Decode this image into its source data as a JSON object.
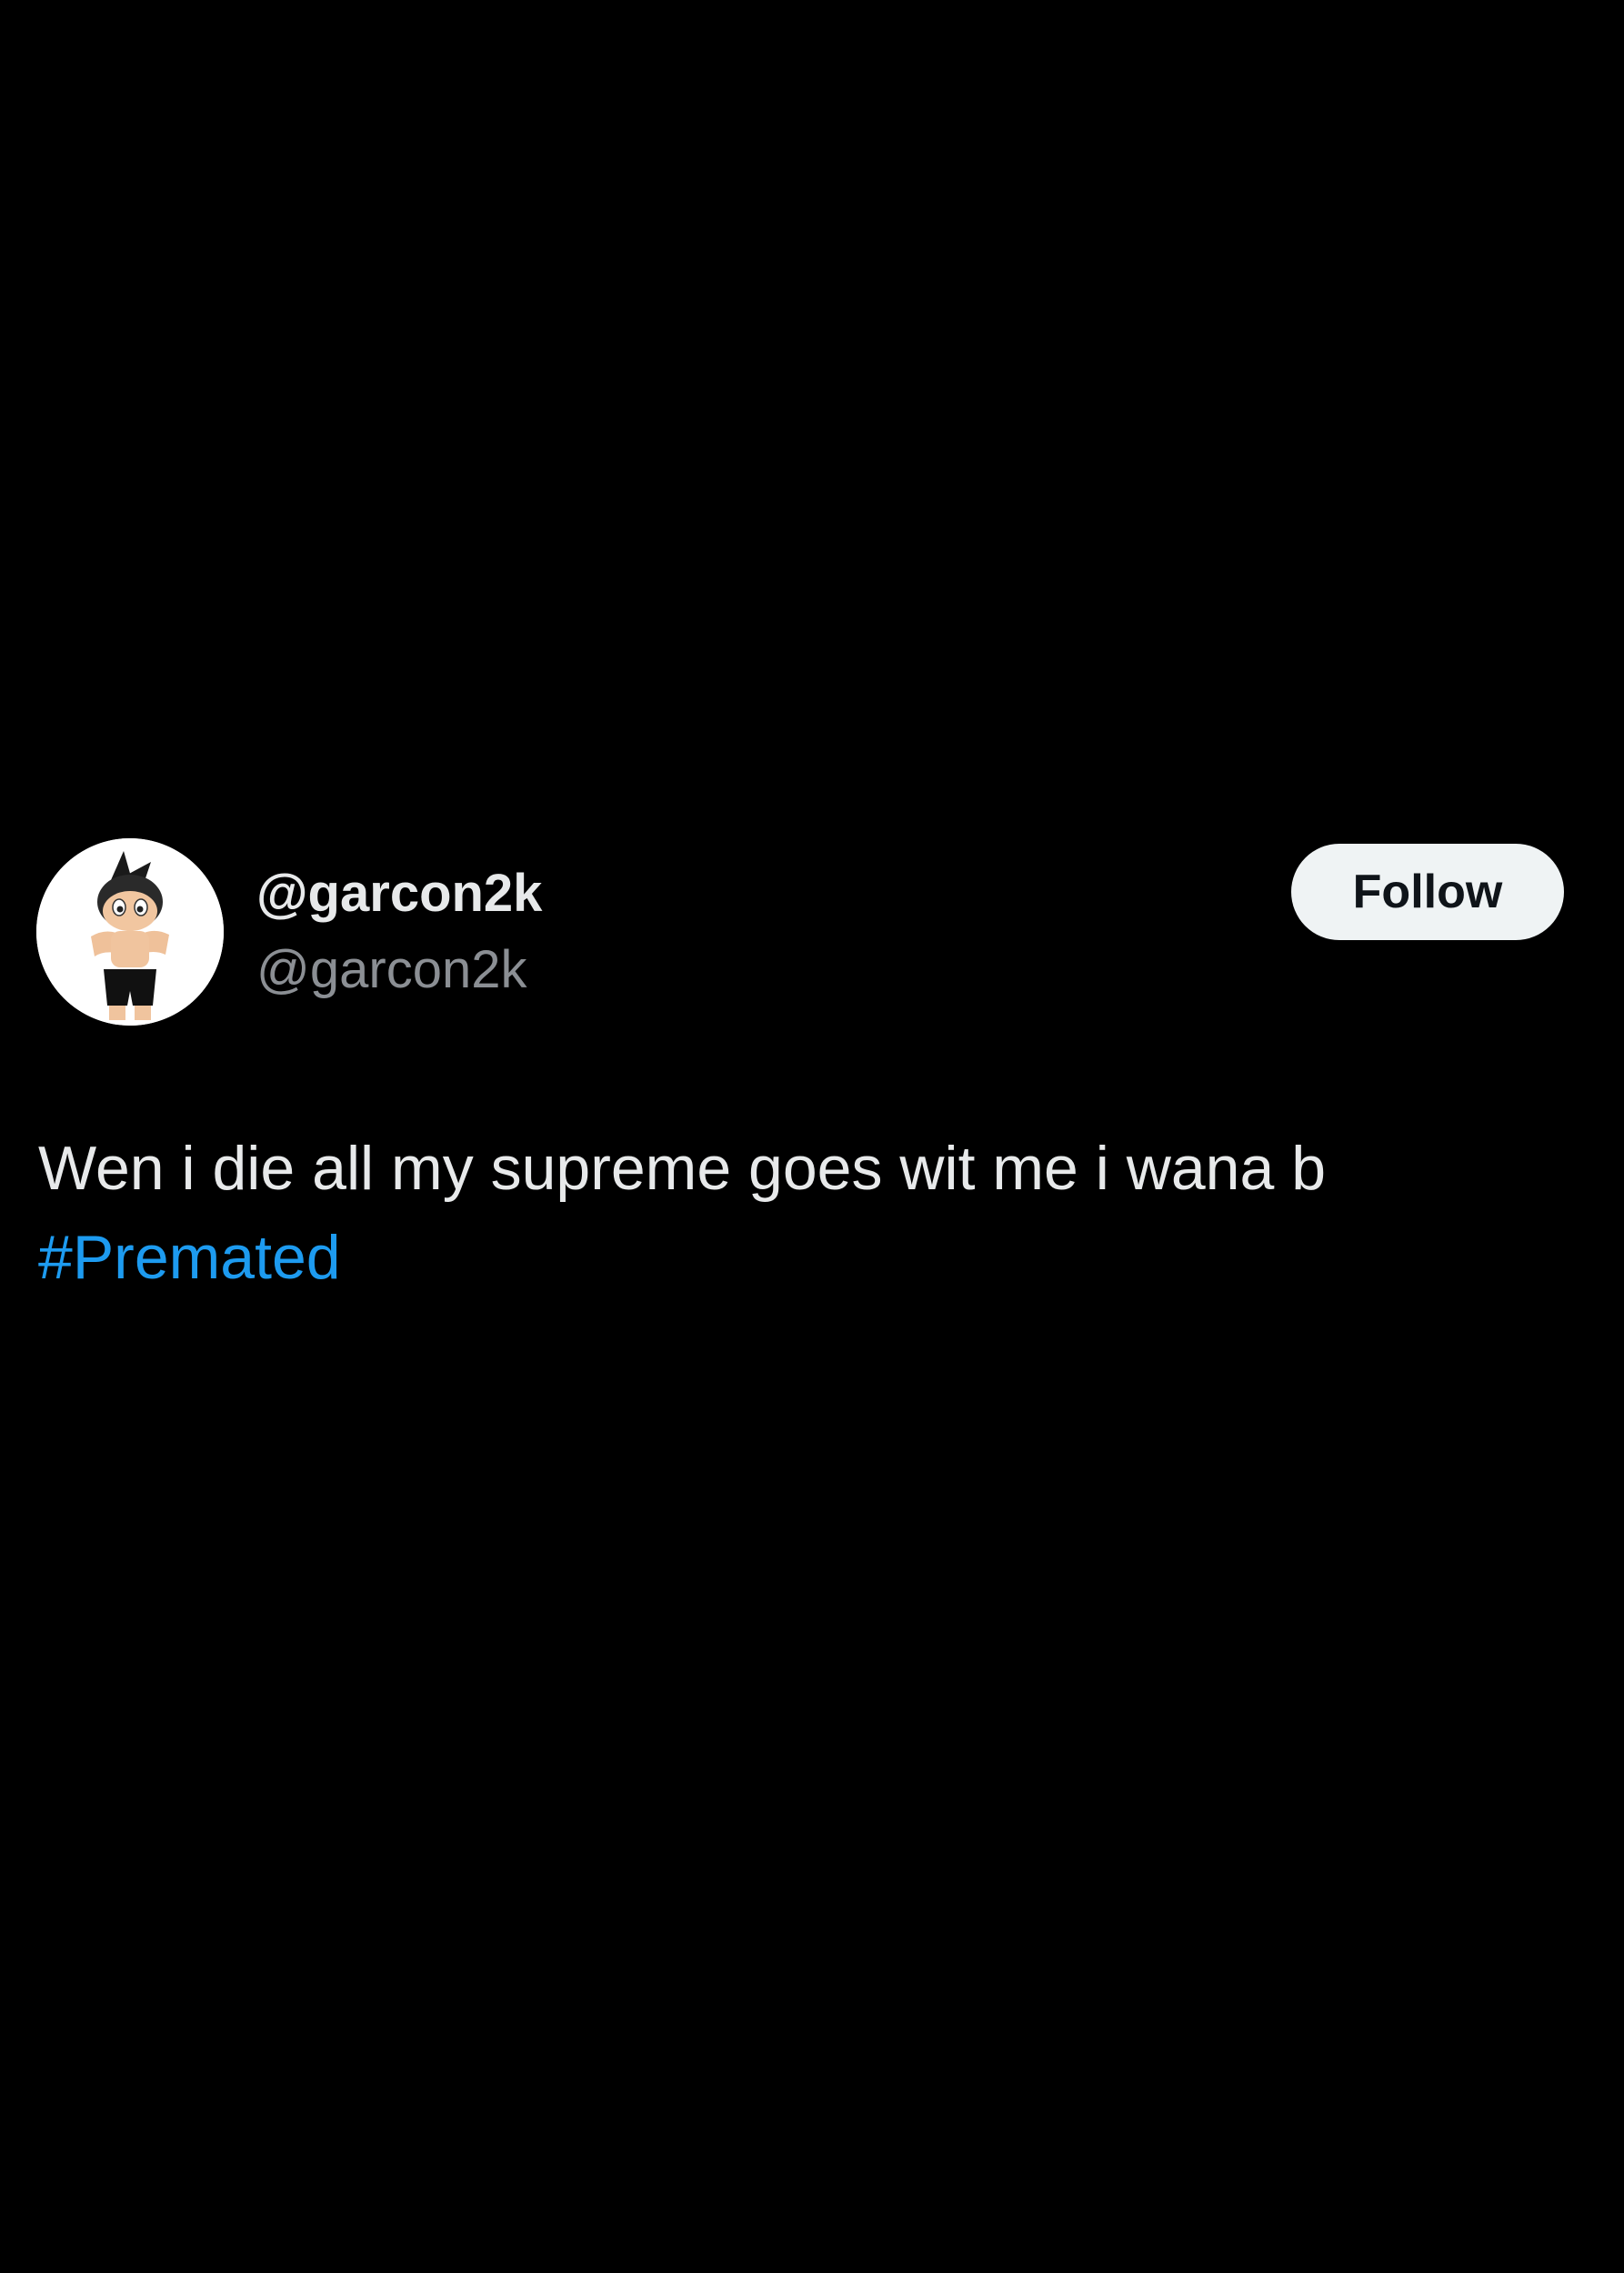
{
  "tweet": {
    "author": {
      "display_name": "@garcon2k",
      "handle": "@garcon2k",
      "avatar_icon": "astro-boy-figure-avatar"
    },
    "follow_label": "Follow",
    "text": "Wen i die all my supreme goes wit me i wana b",
    "hashtag": "#Premated"
  },
  "colors": {
    "background": "#000000",
    "primary_text": "#e7e9ea",
    "secondary_text": "#8b8f94",
    "link": "#1d9bf0",
    "follow_button_bg": "#eff3f4",
    "follow_button_text": "#0f1419"
  }
}
